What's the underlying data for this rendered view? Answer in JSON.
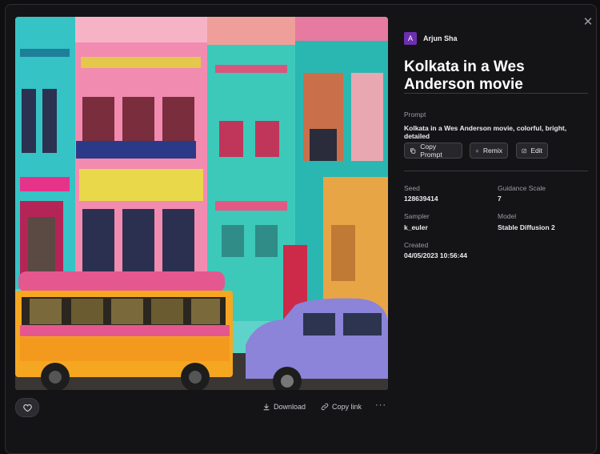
{
  "image": {
    "alt": ""
  },
  "author": {
    "initial": "A",
    "name": "Arjun Sha",
    "avatar_color": "#6c2fb0"
  },
  "title": "Kolkata in a Wes Anderson movie",
  "prompt": {
    "label": "Prompt",
    "text": "Kolkata in a Wes Anderson movie, colorful, bright, detailed"
  },
  "buttons": {
    "copy_prompt": "Copy Prompt",
    "remix": "Remix",
    "edit": "Edit"
  },
  "details": {
    "seed_label": "Seed",
    "seed": "128639414",
    "guidance_label": "Guidance Scale",
    "guidance": "7",
    "sampler_label": "Sampler",
    "sampler": "k_euler",
    "model_label": "Model",
    "model": "Stable Diffusion 2",
    "created_label": "Created",
    "created": "04/05/2023 10:56:44"
  },
  "footer": {
    "download": "Download",
    "copy_link": "Copy link",
    "more": "···"
  },
  "icons": {
    "close": "close-icon",
    "heart": "heart-icon",
    "download": "download-icon",
    "link": "link-icon",
    "copy": "copy-icon",
    "remix": "remix-icon",
    "edit": "edit-icon"
  },
  "colors": {
    "background": "#0f0f12",
    "panel": "#141417",
    "accent": "#6c2fb0"
  }
}
